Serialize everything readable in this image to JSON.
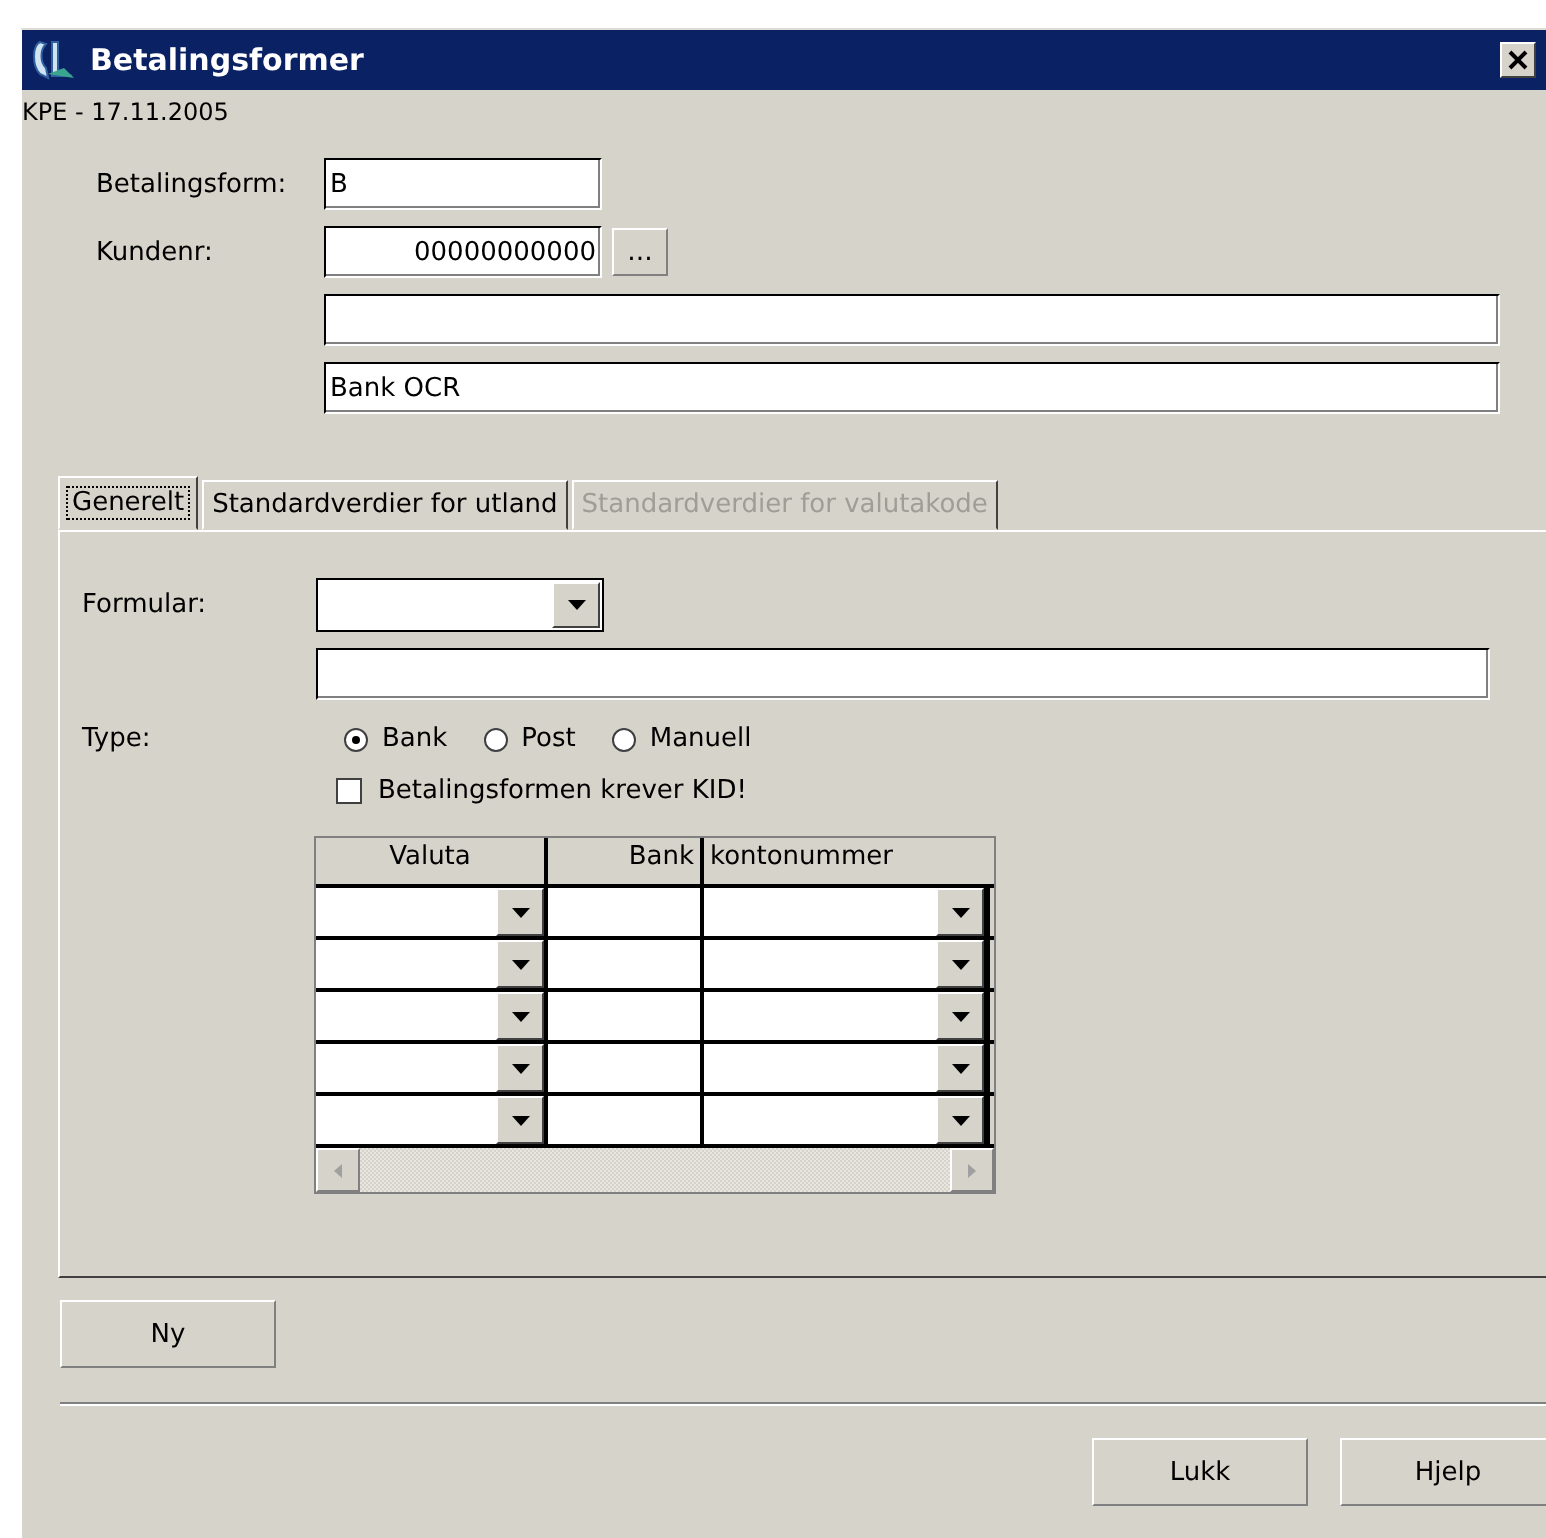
{
  "window": {
    "title": "Betalingsformer",
    "subtitle": "KPE - 17.11.2005"
  },
  "header_fields": [
    {
      "label": "Betalingsform:",
      "value": "B",
      "kind": "short"
    },
    {
      "label": "Kundenr:",
      "value": "00000000000",
      "kind": "lookup",
      "button": "..."
    },
    {
      "kind": "wide"
    },
    {
      "value": "Bank OCR",
      "kind": "wide"
    }
  ],
  "tabs": [
    {
      "label": "Generelt",
      "selected": true,
      "disabled": false
    },
    {
      "label": "Standardverdier for utland",
      "selected": false,
      "disabled": false
    },
    {
      "label": "Standardverdier for valutakode",
      "selected": false,
      "disabled": true
    }
  ],
  "general": {
    "formular_label": "Formular:",
    "type_label": "Type:",
    "type_options": [
      {
        "label": "Bank",
        "selected": true
      },
      {
        "label": "Post",
        "selected": false
      },
      {
        "label": "Manuell",
        "selected": false
      }
    ],
    "kid_checkbox": {
      "label": "Betalingsformen krever KID!",
      "checked": false
    }
  },
  "table": {
    "columns": [
      {
        "label": "Valuta",
        "kind": "dropdown"
      },
      {
        "label": "Bank",
        "kind": "text"
      },
      {
        "label": "kontonummer",
        "kind": "dropdown"
      }
    ],
    "rows": [
      {
        "kind": "empty"
      },
      {
        "kind": "empty"
      },
      {
        "kind": "empty"
      },
      {
        "kind": "empty"
      },
      {
        "kind": "empty"
      }
    ]
  },
  "new_button": "Ny",
  "dialog_buttons": [
    "Lukk",
    "Hjelp"
  ]
}
